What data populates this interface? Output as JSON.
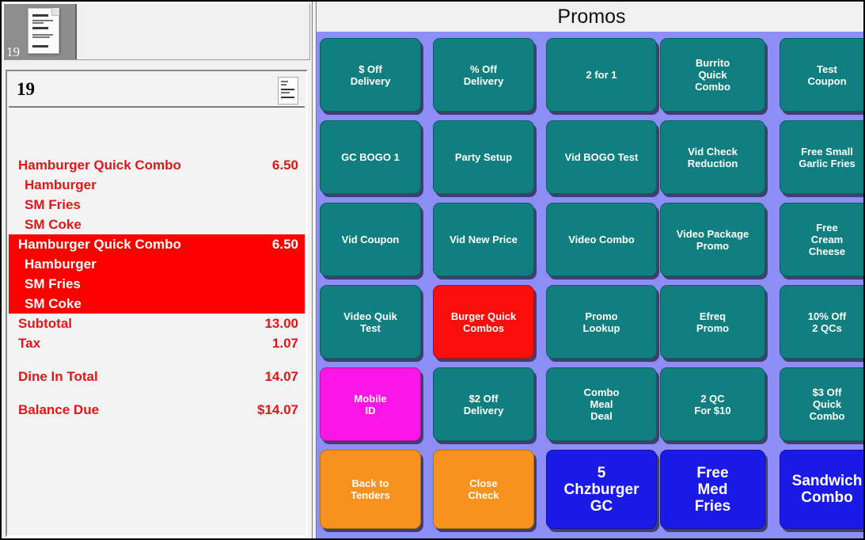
{
  "window": {
    "thumbnail": {
      "label": "19",
      "icon": "receipt-thumbnail-icon"
    }
  },
  "check": {
    "id": "19",
    "doc_icon": "receipt-icon",
    "groups": [
      {
        "highlighted": false,
        "name": "Hamburger Quick Combo",
        "price": "6.50",
        "modifiers": [
          "Hamburger",
          "SM Fries",
          "SM Coke"
        ]
      },
      {
        "highlighted": true,
        "name": "Hamburger Quick Combo",
        "price": "6.50",
        "modifiers": [
          "Hamburger",
          "SM Fries",
          "SM Coke"
        ]
      }
    ],
    "totals": [
      {
        "label": "Subtotal",
        "value": "13.00",
        "gap_before": false
      },
      {
        "label": "Tax",
        "value": "1.07",
        "gap_before": false
      },
      {
        "label": "Dine In Total",
        "value": "14.07",
        "gap_before": true
      },
      {
        "label": "Balance Due",
        "value": "$14.07",
        "gap_before": true
      }
    ]
  },
  "promos": {
    "title": "Promos",
    "colors": {
      "teal": "#117f7f",
      "red": "#fa0d0d",
      "magenta": "#fb16e8",
      "orange": "#f7921e",
      "blue": "#1a1ae6",
      "panel_background": "#8d8df6"
    },
    "buttons": [
      {
        "label": "$ Off\nDelivery",
        "color": "teal",
        "col": 0,
        "row": 0
      },
      {
        "label": "% Off\nDelivery",
        "color": "teal",
        "col": 1,
        "row": 0
      },
      {
        "label": "2 for 1",
        "color": "teal",
        "col": 2,
        "row": 0
      },
      {
        "label": "Burrito\nQuick\nCombo",
        "color": "teal",
        "col": 3,
        "row": 0
      },
      {
        "label": "Test\nCoupon",
        "color": "teal",
        "col": 4,
        "row": 0
      },
      {
        "label": "GC BOGO 1",
        "color": "teal",
        "col": 0,
        "row": 1
      },
      {
        "label": "Party Setup",
        "color": "teal",
        "col": 1,
        "row": 1
      },
      {
        "label": "Vid BOGO Test",
        "color": "teal",
        "col": 2,
        "row": 1
      },
      {
        "label": "Vid Check\nReduction",
        "color": "teal",
        "col": 3,
        "row": 1
      },
      {
        "label": "Free Small\nGarlic Fries",
        "color": "teal",
        "col": 4,
        "row": 1
      },
      {
        "label": "Vid Coupon",
        "color": "teal",
        "col": 0,
        "row": 2
      },
      {
        "label": "Vid New Price",
        "color": "teal",
        "col": 1,
        "row": 2
      },
      {
        "label": "Video Combo",
        "color": "teal",
        "col": 2,
        "row": 2
      },
      {
        "label": "Video Package\nPromo",
        "color": "teal",
        "col": 3,
        "row": 2
      },
      {
        "label": "Free\nCream\nCheese",
        "color": "teal",
        "col": 4,
        "row": 2
      },
      {
        "label": "Video Quik\nTest",
        "color": "teal",
        "col": 0,
        "row": 3
      },
      {
        "label": "Burger Quick\nCombos",
        "color": "red",
        "col": 1,
        "row": 3
      },
      {
        "label": "Promo\nLookup",
        "color": "teal",
        "col": 2,
        "row": 3
      },
      {
        "label": "Efreq\nPromo",
        "color": "teal",
        "col": 3,
        "row": 3
      },
      {
        "label": "10% Off\n2 QCs",
        "color": "teal",
        "col": 4,
        "row": 3
      },
      {
        "label": "Mobile\nID",
        "color": "magenta",
        "col": 0,
        "row": 4
      },
      {
        "label": "$2 Off\nDelivery",
        "color": "teal",
        "col": 1,
        "row": 4
      },
      {
        "label": "Combo\nMeal\nDeal",
        "color": "teal",
        "col": 2,
        "row": 4
      },
      {
        "label": "2 QC\nFor $10",
        "color": "teal",
        "col": 3,
        "row": 4
      },
      {
        "label": "$3 Off\nQuick\nCombo",
        "color": "teal",
        "col": 4,
        "row": 4
      },
      {
        "label": "Back to\nTenders",
        "color": "orange",
        "col": 0,
        "row": 5
      },
      {
        "label": "Close\nCheck",
        "color": "orange",
        "col": 1,
        "row": 5
      },
      {
        "label": "5\nChzburger\nGC",
        "color": "blue",
        "col": 2,
        "row": 5
      },
      {
        "label": "Free\nMed\nFries",
        "color": "blue",
        "col": 3,
        "row": 5
      },
      {
        "label": "Sandwich\nCombo",
        "color": "blue",
        "col": 4,
        "row": 5
      }
    ]
  }
}
